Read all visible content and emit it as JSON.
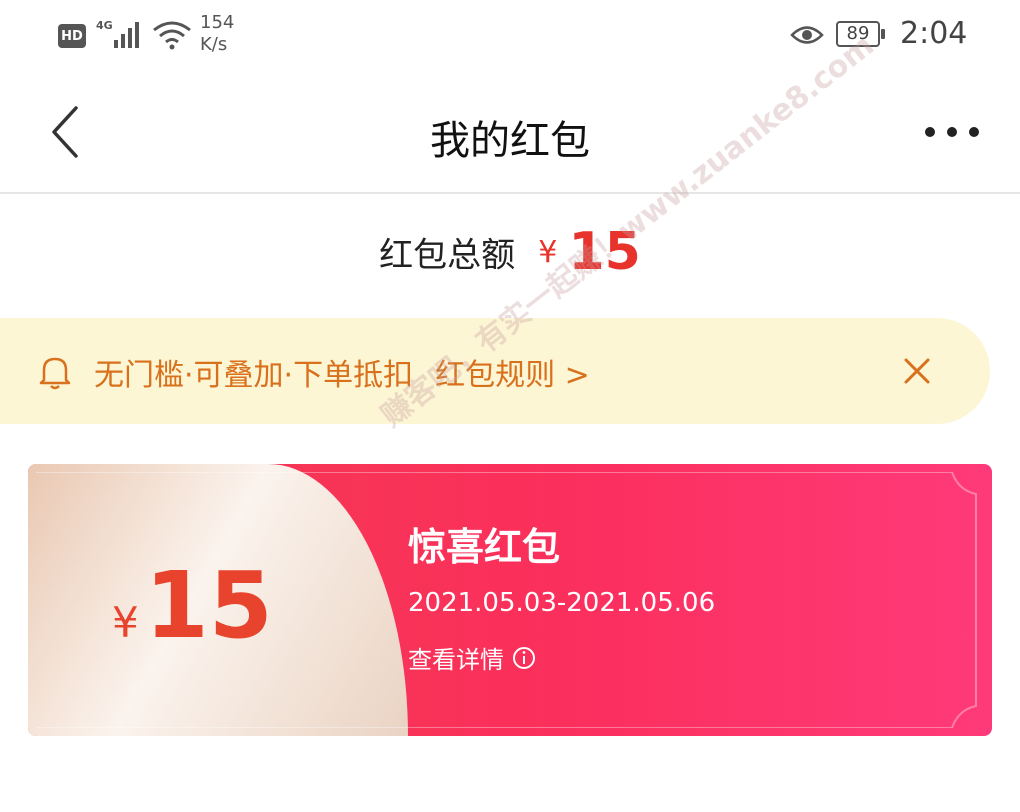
{
  "status_bar": {
    "hd_label": "HD",
    "network_label": "4G",
    "speed_value": "154",
    "speed_unit": "K/s",
    "battery": "89",
    "time": "2:04"
  },
  "nav": {
    "title": "我的红包",
    "back_icon": "chevron-left-icon",
    "more_icon": "more-dots-icon"
  },
  "summary": {
    "label": "红包总额",
    "currency": "¥",
    "amount": "15"
  },
  "notice": {
    "text": "无门槛·可叠加·下单抵扣",
    "rules_link": "红包规则 >",
    "bell_icon": "bell-icon",
    "close_icon": "close-icon"
  },
  "coupon": {
    "currency": "¥",
    "amount": "15",
    "title": "惊喜红包",
    "validity": "2021.05.03-2021.05.06",
    "detail_link": "查看详情"
  },
  "watermark": {
    "text": "赚客吧，有实一起赚！www.zuanke8.com"
  },
  "colors": {
    "accent_red": "#e8322c",
    "notice_bg": "#fdf6d5",
    "notice_text": "#d8701c",
    "card_pink": "#fb2f5c"
  }
}
